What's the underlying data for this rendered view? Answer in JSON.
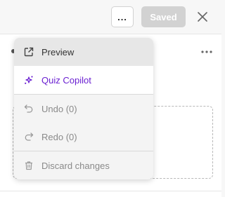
{
  "topbar": {
    "more_label": "...",
    "saved_label": "Saved"
  },
  "menu": {
    "items": [
      {
        "label": "Preview",
        "icon": "external-link-icon"
      },
      {
        "label": "Quiz Copilot",
        "icon": "sparkle-icon",
        "color": "#6a1fd1"
      },
      {
        "label": "Undo (0)",
        "icon": "undo-icon"
      },
      {
        "label": "Redo (0)",
        "icon": "redo-icon"
      },
      {
        "label": "Discard changes",
        "icon": "trash-icon"
      }
    ]
  },
  "colors": {
    "accent_purple": "#6a1fd1",
    "disabled_button": "#d2d2d2"
  }
}
